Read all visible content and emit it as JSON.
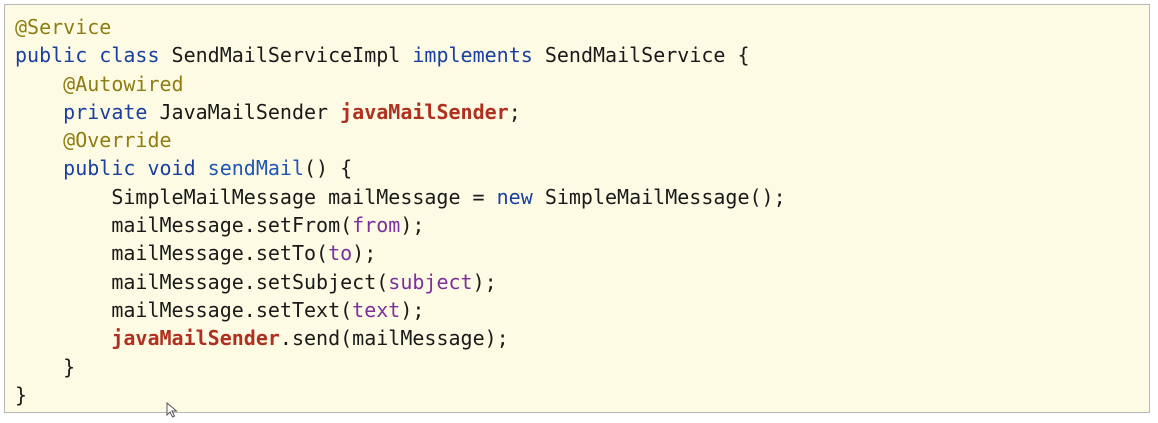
{
  "editor": {
    "lines": [
      [
        {
          "t": "@Service",
          "k": "annotation"
        }
      ],
      [
        {
          "t": "public class ",
          "k": "keyword"
        },
        {
          "t": "SendMailServiceImpl ",
          "k": "plain"
        },
        {
          "t": "implements ",
          "k": "keyword"
        },
        {
          "t": "SendMailService {",
          "k": "plain"
        }
      ],
      [
        {
          "t": "    ",
          "k": "plain"
        },
        {
          "t": "@Autowired",
          "k": "annotation"
        }
      ],
      [
        {
          "t": "    ",
          "k": "plain"
        },
        {
          "t": "private ",
          "k": "keyword"
        },
        {
          "t": "JavaMailSender ",
          "k": "plain"
        },
        {
          "t": "javaMailSender",
          "k": "field"
        },
        {
          "t": ";",
          "k": "plain"
        }
      ],
      [
        {
          "t": "    ",
          "k": "plain"
        },
        {
          "t": "@Override",
          "k": "annotation"
        }
      ],
      [
        {
          "t": "    ",
          "k": "plain"
        },
        {
          "t": "public void ",
          "k": "keyword"
        },
        {
          "t": "sendMail",
          "k": "method"
        },
        {
          "t": "() {",
          "k": "plain"
        }
      ],
      [
        {
          "t": "        SimpleMailMessage mailMessage = ",
          "k": "plain"
        },
        {
          "t": "new ",
          "k": "keyword"
        },
        {
          "t": "SimpleMailMessage();",
          "k": "plain"
        }
      ],
      [
        {
          "t": "        mailMessage.setFrom(",
          "k": "plain"
        },
        {
          "t": "from",
          "k": "param"
        },
        {
          "t": ");",
          "k": "plain"
        }
      ],
      [
        {
          "t": "        mailMessage.setTo(",
          "k": "plain"
        },
        {
          "t": "to",
          "k": "param"
        },
        {
          "t": ");",
          "k": "plain"
        }
      ],
      [
        {
          "t": "        mailMessage.setSubject(",
          "k": "plain"
        },
        {
          "t": "subject",
          "k": "param"
        },
        {
          "t": ");",
          "k": "plain"
        }
      ],
      [
        {
          "t": "        mailMessage.setText(",
          "k": "plain"
        },
        {
          "t": "text",
          "k": "param"
        },
        {
          "t": ");",
          "k": "plain"
        }
      ],
      [
        {
          "t": "        ",
          "k": "plain"
        },
        {
          "t": "javaMailSender",
          "k": "field"
        },
        {
          "t": ".send(mailMessage);",
          "k": "plain"
        }
      ],
      [
        {
          "t": "    }",
          "k": "plain"
        }
      ],
      [
        {
          "t": "}",
          "k": "plain"
        }
      ]
    ]
  },
  "colors": {
    "background": "#fdfbe3",
    "annotation": "#8f7d14",
    "keyword": "#1a3fa0",
    "field": "#b03020",
    "method": "#1f55b4",
    "param": "#7d2f9e",
    "text": "#1a1a1a"
  },
  "cursor": {
    "icon": "mouse-pointer-icon"
  }
}
